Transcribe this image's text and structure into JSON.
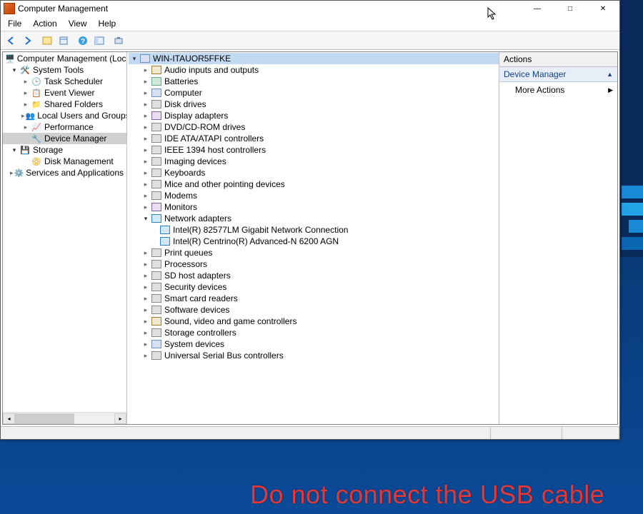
{
  "window": {
    "title": "Computer Management"
  },
  "menu": {
    "file": "File",
    "action": "Action",
    "view": "View",
    "help": "Help"
  },
  "left_tree": {
    "root": "Computer Management (Local",
    "system_tools": "System Tools",
    "task_scheduler": "Task Scheduler",
    "event_viewer": "Event Viewer",
    "shared_folders": "Shared Folders",
    "local_users": "Local Users and Groups",
    "performance": "Performance",
    "device_manager": "Device Manager",
    "storage": "Storage",
    "disk_management": "Disk Management",
    "services_apps": "Services and Applications"
  },
  "dev": {
    "root": "WIN-ITAUOR5FFKE",
    "audio": "Audio inputs and outputs",
    "batteries": "Batteries",
    "computer": "Computer",
    "disk": "Disk drives",
    "display": "Display adapters",
    "dvd": "DVD/CD-ROM drives",
    "ide": "IDE ATA/ATAPI controllers",
    "ieee": "IEEE 1394 host controllers",
    "imaging": "Imaging devices",
    "keyboards": "Keyboards",
    "mice": "Mice and other pointing devices",
    "modems": "Modems",
    "monitors": "Monitors",
    "network": "Network adapters",
    "net1": "Intel(R) 82577LM Gigabit Network Connection",
    "net2": "Intel(R) Centrino(R) Advanced-N 6200 AGN",
    "printq": "Print queues",
    "processors": "Processors",
    "sd": "SD host adapters",
    "security": "Security devices",
    "smart": "Smart card readers",
    "software": "Software devices",
    "sound": "Sound, video and game controllers",
    "storagectl": "Storage controllers",
    "sysdev": "System devices",
    "usb": "Universal Serial Bus controllers"
  },
  "actions": {
    "header": "Actions",
    "section": "Device Manager",
    "more": "More Actions"
  },
  "overlay": "Do not connect the USB cable"
}
